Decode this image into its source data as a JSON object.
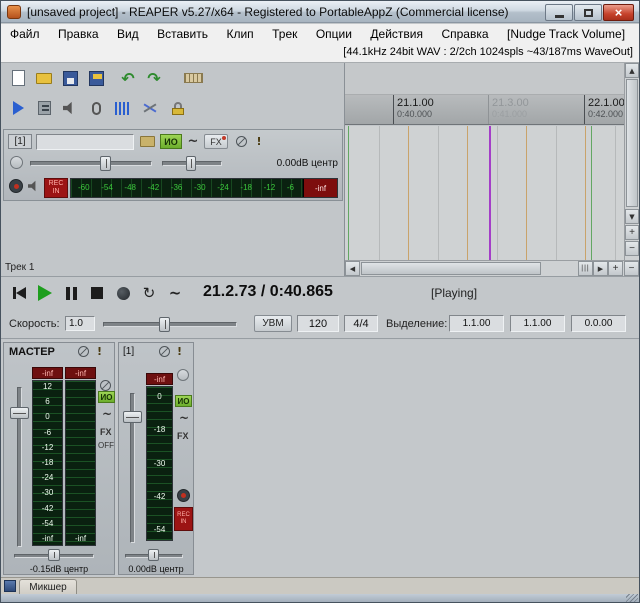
{
  "window": {
    "title": "[unsaved project] - REAPER v5.27/x64 - Registered to PortableAppZ (Commercial license)"
  },
  "menu": {
    "items": [
      "Файл",
      "Правка",
      "Вид",
      "Вставить",
      "Клип",
      "Трек",
      "Опции",
      "Действия",
      "Справка"
    ],
    "extra": "[Nudge Track Volume]"
  },
  "status_line": "[44.1kHz 24bit WAV : 2/2ch 1024spls ~43/187ms WaveOut]",
  "icons": {
    "warning": "!",
    "loop": "↻",
    "envelope": "~",
    "undo": "↶",
    "redo": "↷"
  },
  "track_panel": {
    "number": "[1]",
    "io": "ИО",
    "fx": "FX",
    "volume": "0.00dB",
    "pan": "центр",
    "rec_in": "REC IN",
    "meter": {
      "scale": [
        "-60",
        "-54",
        "-48",
        "-42",
        "-36",
        "-30",
        "-24",
        "-18",
        "-12",
        "-6"
      ],
      "peak": "-inf"
    }
  },
  "track_list": {
    "track1": "Трек 1"
  },
  "ruler": {
    "marks": [
      {
        "beat": "21.1.00",
        "time": "0:40.000"
      },
      {
        "beat": "21.3.00",
        "time": "0:41.000"
      },
      {
        "beat": "22.1.00",
        "time": "0:42.000"
      }
    ]
  },
  "transport": {
    "position": "21.2.73 / 0:40.865",
    "status": "[Playing]"
  },
  "rate": {
    "label": "Скорость:",
    "value": "1.0"
  },
  "tempo": {
    "uvm": "УВМ",
    "bpm": "120",
    "timesig": "4/4"
  },
  "selection": {
    "label": "Выделение:",
    "start": "1.1.00",
    "end": "1.1.00",
    "length": "0.0.00"
  },
  "mixer": {
    "master": {
      "name": "МАСТЕР",
      "peak_l": "-inf",
      "peak_r": "-inf",
      "scale": [
        "12",
        "6",
        "0",
        "-6",
        "-12",
        "-18",
        "-24",
        "-30",
        "-42",
        "-54"
      ],
      "bottom_l": "-inf",
      "bottom_r": "-inf",
      "io": "ИО",
      "fx": "FX",
      "fx_state": "OFF",
      "volume": "-0.15dB",
      "pan": "центр"
    },
    "channel1": {
      "name": "[1]",
      "peak": "-inf",
      "scale": [
        "0",
        "-18",
        "-30",
        "-42",
        "-54"
      ],
      "io": "ИО",
      "fx": "FX",
      "rec_in": "REC IN",
      "volume": "0.00dB",
      "pan": "центр"
    }
  },
  "docker": {
    "mixer_tab": "Микшер"
  },
  "colors": {
    "play_green": "#1e9e1e",
    "record_red": "#9c1414",
    "meter_text_green": "#3cc83c",
    "playhead_purple": "#a43ec8",
    "io_button_green": "#7ec43e"
  }
}
